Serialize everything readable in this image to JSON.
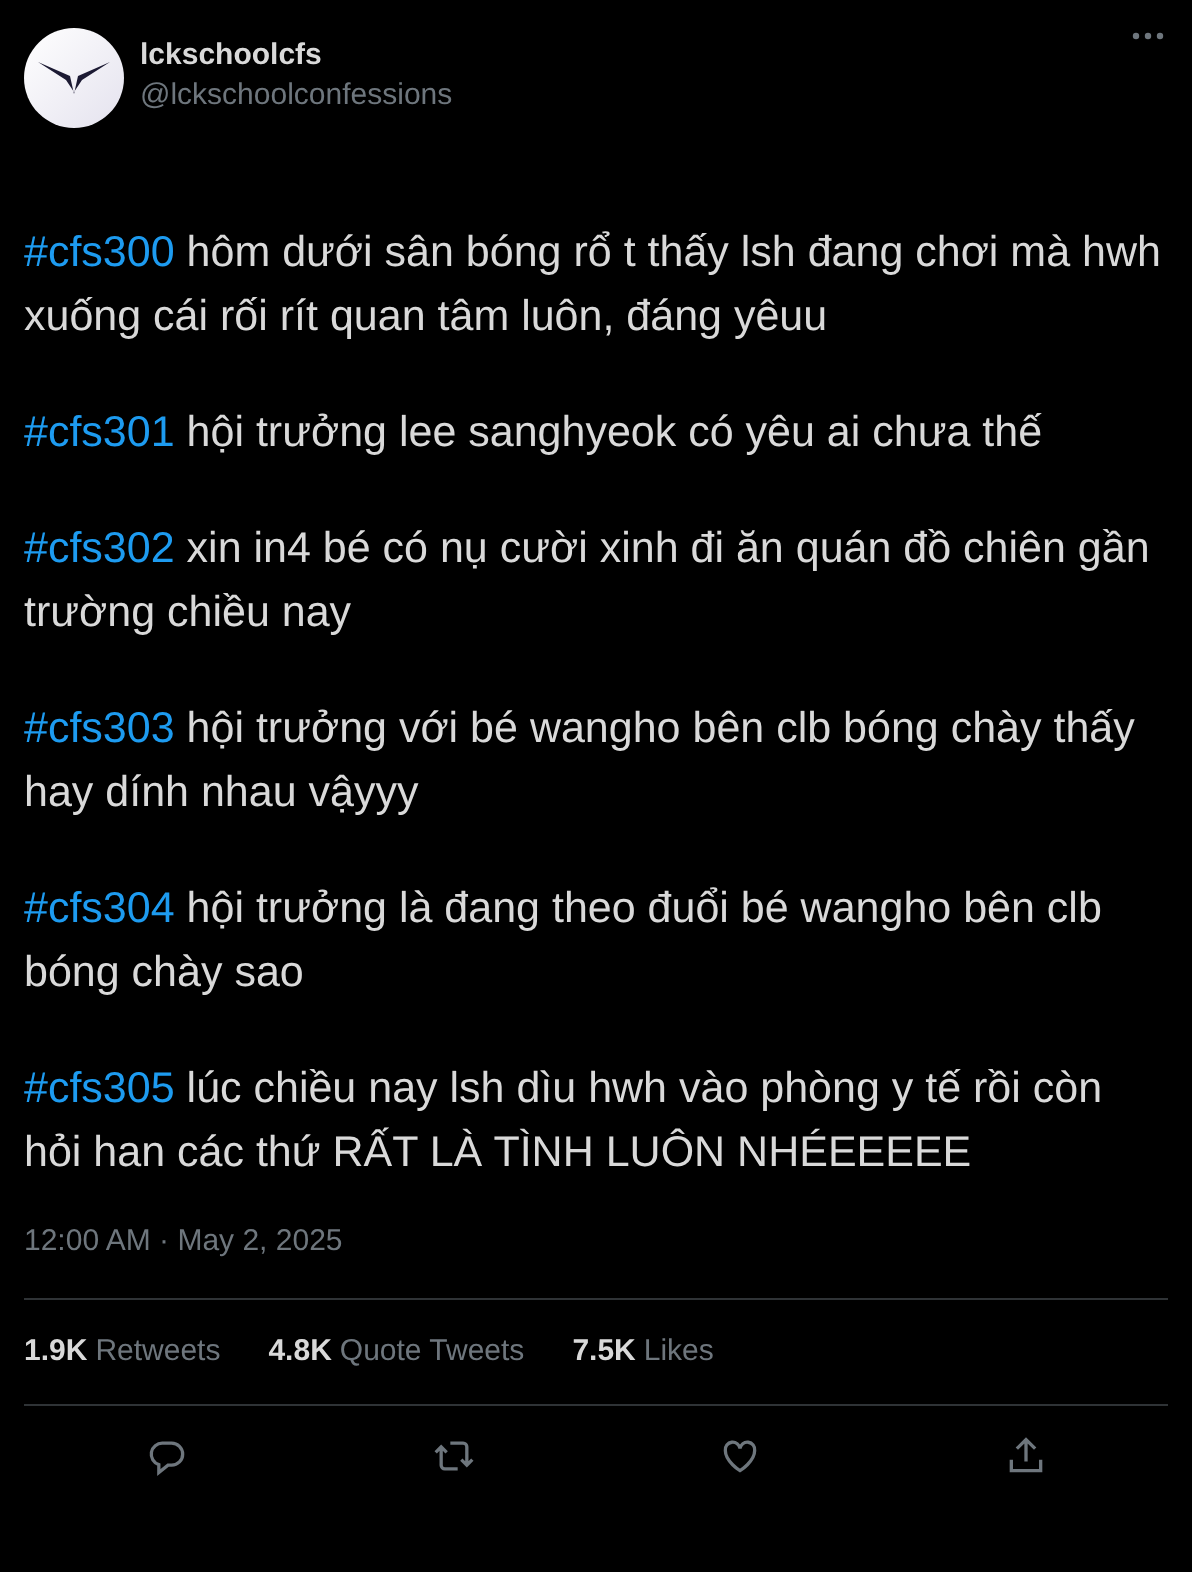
{
  "author": {
    "name": "lckschoolcfs",
    "handle": "@lckschoolconfessions"
  },
  "posts": [
    {
      "hashtag": "#cfs300",
      "text": "hôm dưới sân bóng rổ t thấy lsh đang chơi mà hwh xuống cái rối rít quan tâm luôn, đáng yêuu"
    },
    {
      "hashtag": "#cfs301",
      "text": "hội trưởng lee sanghyeok có yêu ai chưa thế"
    },
    {
      "hashtag": "#cfs302",
      "text": "xin in4 bé có nụ cười xinh đi ăn quán đồ chiên gần trường chiều nay"
    },
    {
      "hashtag": "#cfs303",
      "text": "hội trưởng với bé wangho bên clb bóng chày thấy hay dính nhau vậyyy"
    },
    {
      "hashtag": "#cfs304",
      "text": "hội trưởng là đang theo đuổi bé wangho bên clb bóng chày sao"
    },
    {
      "hashtag": "#cfs305",
      "text": "lúc chiều nay lsh dìu hwh vào phòng y tế rồi còn hỏi han các thứ RẤT LÀ TÌNH LUÔN NHÉEEEEE"
    }
  ],
  "timestamp": "12:00 AM · May 2, 2025",
  "stats": [
    {
      "count": "1.9K",
      "label": "Retweets"
    },
    {
      "count": "4.8K",
      "label": "Quote Tweets"
    },
    {
      "count": "7.5K",
      "label": "Likes"
    }
  ],
  "actions": [
    {
      "kind": "reply"
    },
    {
      "kind": "retweet"
    },
    {
      "kind": "like"
    },
    {
      "kind": "share"
    }
  ]
}
